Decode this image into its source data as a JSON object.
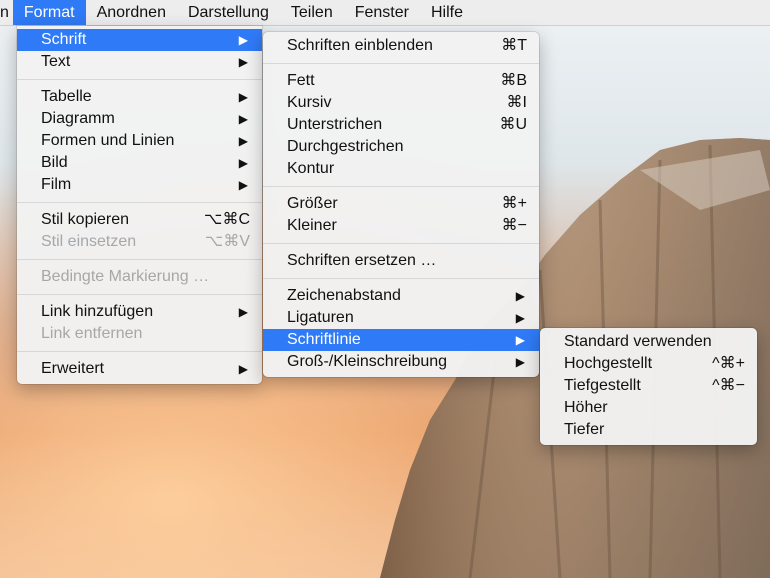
{
  "colors": {
    "accent": "#2f7af6",
    "menu_bg": "#f2f2f2",
    "disabled": "#a7a7a7"
  },
  "menubar": {
    "items": [
      "n",
      "Format",
      "Anordnen",
      "Darstellung",
      "Teilen",
      "Fenster",
      "Hilfe"
    ],
    "active_index": 1
  },
  "format_menu": {
    "schrift": "Schrift",
    "text": "Text",
    "tabelle": "Tabelle",
    "diagramm": "Diagramm",
    "formen": "Formen und Linien",
    "bild": "Bild",
    "film": "Film",
    "stil_kopieren": "Stil kopieren",
    "stil_kopieren_sc": "⌥⌘C",
    "stil_einsetzen": "Stil einsetzen",
    "stil_einsetzen_sc": "⌥⌘V",
    "bedingte": "Bedingte Markierung …",
    "link_hinzufuegen": "Link hinzufügen",
    "link_entfernen": "Link entfernen",
    "erweitert": "Erweitert",
    "submenu_arrow": "▶"
  },
  "font_menu": {
    "einblenden": "Schriften einblenden",
    "einblenden_sc": "⌘T",
    "fett": "Fett",
    "fett_sc": "⌘B",
    "kursiv": "Kursiv",
    "kursiv_sc": "⌘I",
    "unterstrichen": "Unterstrichen",
    "unterstrichen_sc": "⌘U",
    "durchgestrichen": "Durchgestrichen",
    "kontur": "Kontur",
    "groesser": "Größer",
    "groesser_sc": "⌘+",
    "kleiner": "Kleiner",
    "kleiner_sc": "⌘−",
    "ersetzen": "Schriften ersetzen …",
    "zeichenabstand": "Zeichenabstand",
    "ligaturen": "Ligaturen",
    "schriftlinie": "Schriftlinie",
    "gross_klein": "Groß-/Kleinschreibung"
  },
  "baseline_menu": {
    "standard": "Standard verwenden",
    "hochgestellt": "Hochgestellt",
    "hochgestellt_sc": "^⌘+",
    "tiefgestellt": "Tiefgestellt",
    "tiefgestellt_sc": "^⌘−",
    "hoeher": "Höher",
    "tiefer": "Tiefer"
  }
}
